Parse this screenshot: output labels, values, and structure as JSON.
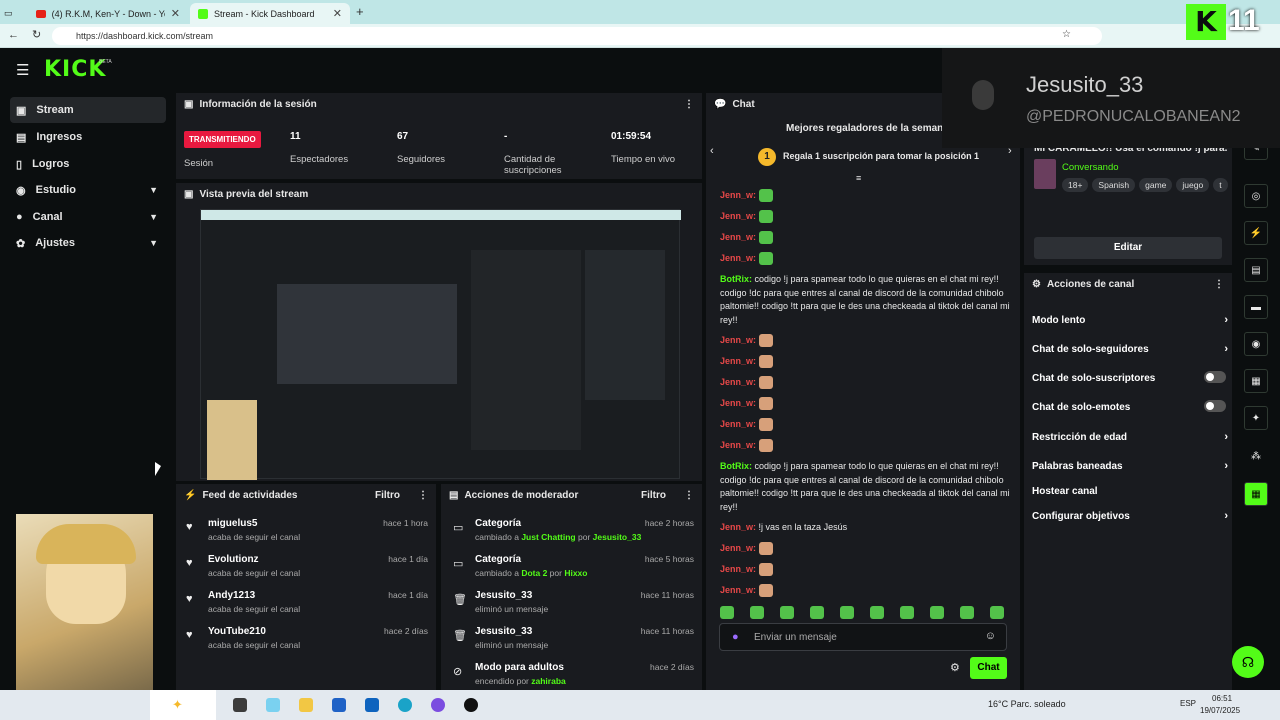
{
  "browser": {
    "tabs": [
      {
        "title": "(4) R.K.M, Ken-Y - Down - YouTub"
      },
      {
        "title": "Stream - Kick Dashboard"
      }
    ],
    "url": "https://dashboard.kick.com/stream"
  },
  "sidebar": {
    "logo": "KICK",
    "logo_badge": "BETA",
    "items": [
      {
        "label": "Stream",
        "icon": "video-icon"
      },
      {
        "label": "Ingresos",
        "icon": "chart-icon"
      },
      {
        "label": "Logros",
        "icon": "trophy-icon"
      },
      {
        "label": "Estudio",
        "icon": "studio-icon"
      },
      {
        "label": "Canal",
        "icon": "user-icon"
      },
      {
        "label": "Ajustes",
        "icon": "gear-icon"
      }
    ]
  },
  "session": {
    "title": "Información de la sesión",
    "live_badge": "TRANSMITIENDO",
    "session_label": "Sesión",
    "stats": [
      {
        "value": "11",
        "label": "Espectadores"
      },
      {
        "value": "67",
        "label": "Seguidores"
      },
      {
        "value": "-",
        "label": "Cantidad de suscripciones"
      },
      {
        "value": "01:59:54",
        "label": "Tiempo en vivo"
      }
    ]
  },
  "preview": {
    "title": "Vista previa del stream"
  },
  "activity": {
    "title": "Feed de actividades",
    "filter": "Filtro",
    "items": [
      {
        "name": "miguelus5",
        "sub": "acaba de seguir el canal",
        "time": "hace 1 hora"
      },
      {
        "name": "Evolutionz",
        "sub": "acaba de seguir el canal",
        "time": "hace 1 día"
      },
      {
        "name": "Andy1213",
        "sub": "acaba de seguir el canal",
        "time": "hace 1 día"
      },
      {
        "name": "YouTube210",
        "sub": "acaba de seguir el canal",
        "time": "hace 2 días"
      }
    ]
  },
  "modactions": {
    "title": "Acciones de moderador",
    "filter": "Filtro",
    "items": [
      {
        "name": "Categoría",
        "pre": "cambiado a ",
        "hl1": "Just Chatting",
        "mid": " por ",
        "hl2": "Jesusito_33",
        "time": "hace 2 horas"
      },
      {
        "name": "Categoría",
        "pre": "cambiado a ",
        "hl1": "Dota 2",
        "mid": " por ",
        "hl2": "Hixxo",
        "time": "hace 5 horas"
      },
      {
        "name": "Jesusito_33",
        "pre": "eliminó un mensaje",
        "hl1": "",
        "mid": "",
        "hl2": "",
        "time": "hace 11 horas"
      },
      {
        "name": "Jesusito_33",
        "pre": "eliminó un mensaje",
        "hl1": "",
        "mid": "",
        "hl2": "",
        "time": "hace 11 horas"
      },
      {
        "name": "Modo para adultos",
        "pre": "encendido por ",
        "hl1": "zahiraba",
        "mid": "",
        "hl2": "",
        "time": "hace 2 días"
      }
    ]
  },
  "chat": {
    "title": "Chat",
    "top_gifters": "Mejores regaladores de la semana",
    "gift_rank": "1",
    "gift_prompt": "Regala 1 suscripción para tomar la posición 1",
    "user": "Jenn_w:",
    "bot": "BotRix:",
    "bot_msg": "codigo !j para spamear todo lo que quieras en el chat mi rey!! codigo !dc para que entres al canal de discord de la comunidad chibolo paltomie!! codigo !tt para que le des una checkeada al tiktok del canal mi rey!!",
    "jenn_text": "!j vas en la taza Jesús",
    "input_placeholder": "Enviar un mensaje",
    "send": "Chat"
  },
  "overlay": {
    "name": "Jesusito_33",
    "handle": "@PEDRONUCALOBANEAN2",
    "viewers": "11"
  },
  "streaminfo": {
    "title": "Mi CARAMELO!! Usa el comando !j para...",
    "category": "Conversando",
    "tags": [
      "18+",
      "Spanish",
      "game",
      "juego",
      "t"
    ],
    "edit": "Editar"
  },
  "channel_actions": {
    "title": "Acciones de canal",
    "items": [
      {
        "label": "Modo lento",
        "kind": "arrow"
      },
      {
        "label": "Chat de solo-seguidores",
        "kind": "arrow"
      },
      {
        "label": "Chat de solo-suscriptores",
        "kind": "toggle"
      },
      {
        "label": "Chat de solo-emotes",
        "kind": "toggle"
      },
      {
        "label": "Restricción de edad",
        "kind": "arrow"
      },
      {
        "label": "Palabras baneadas",
        "kind": "arrow"
      },
      {
        "label": "Hostear canal",
        "kind": "none"
      },
      {
        "label": "Configurar objetivos",
        "kind": "arrow"
      }
    ]
  },
  "taskbar": {
    "weather": "16°C  Parc. soleado",
    "lang": "ESP",
    "time": "06:51",
    "date": "19/07/2025"
  },
  "colors": {
    "accent": "#53fc18",
    "live": "#e8193f",
    "panel": "#191b1f",
    "bg": "#0b0e0f"
  }
}
